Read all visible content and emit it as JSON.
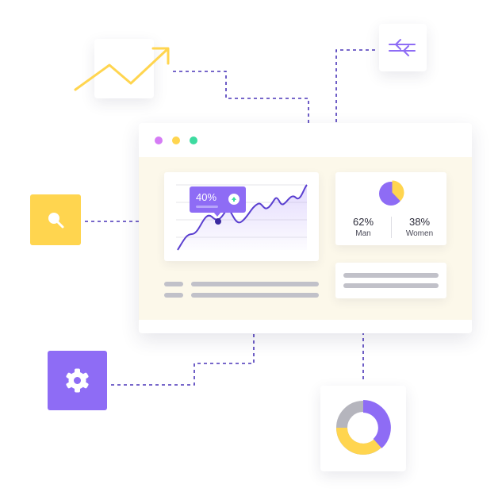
{
  "colors": {
    "accent_purple": "#8e6cf5",
    "accent_yellow": "#ffd54f",
    "connector": "#4a35b8",
    "panel_bg": "#fcf8ea",
    "bar_gray": "#c1c1c9"
  },
  "icons": {
    "trend": "trend-up-arrow-icon",
    "filter": "arrows-icon",
    "search": "search-icon",
    "settings": "gear-icon",
    "donut": "donut-chart-icon"
  },
  "window": {
    "dots": [
      "#d57cf5",
      "#ffd54f",
      "#3ddba0"
    ]
  },
  "line_chart": {
    "badge": "40%"
  },
  "pie": {
    "share_fraction": 0.62,
    "stats": [
      {
        "value": "62%",
        "label": "Man"
      },
      {
        "value": "38%",
        "label": "Women"
      }
    ]
  }
}
